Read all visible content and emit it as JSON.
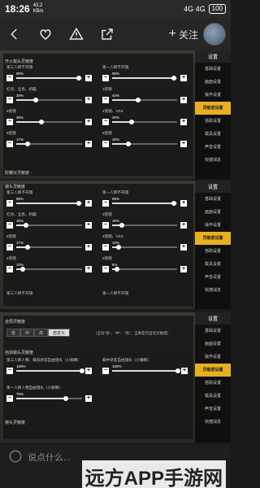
{
  "status": {
    "time": "18:26",
    "net_speed": "43.2",
    "net_unit": "KB/s",
    "signal": "4G 4G",
    "battery": "100"
  },
  "nav": {
    "follow": "关注",
    "plus": "+"
  },
  "menu": {
    "title": "设置",
    "items": [
      "基础设置",
      "画面设置",
      "操作设置",
      "灵敏度设置",
      "拾取设置",
      "载具设置",
      "声音设置",
      "快捷消息"
    ],
    "active_index": 3
  },
  "shot1": {
    "section": "开火镜头灵敏度",
    "left_col": [
      {
        "label": "第三人称不开镜",
        "pct": "95%",
        "value": 95
      },
      {
        "label": "红点、全息、机瞄",
        "pct": "30%",
        "value": 30
      },
      {
        "label": "8倍镜",
        "pct": "38%",
        "value": 38
      },
      {
        "label": "6倍镜",
        "pct": "17%",
        "value": 17
      }
    ],
    "right_col": [
      {
        "label": "第一人称不开镜",
        "pct": "95%",
        "value": 95
      },
      {
        "label": "2倍镜",
        "pct": "40%",
        "value": 40
      },
      {
        "label": "4倍镜、VSS",
        "pct": "30%",
        "value": 30
      },
      {
        "label": "8倍镜",
        "pct": "25%",
        "value": 25
      }
    ],
    "footer": "陀螺仪灵敏度 -"
  },
  "shot2": {
    "section": "镜头灵敏度",
    "left_col": [
      {
        "label": "第三人称不开镜",
        "pct": "95%",
        "value": 95
      },
      {
        "label": "红点、全息、机瞄",
        "pct": "15%",
        "value": 15
      },
      {
        "label": "8倍镜",
        "pct": "17%",
        "value": 17
      },
      {
        "label": "4倍镜",
        "pct": "10%",
        "value": 10
      }
    ],
    "right_col": [
      {
        "label": "第一人称不开镜",
        "pct": "95%",
        "value": 95
      },
      {
        "label": "2倍镜",
        "pct": "15%",
        "value": 15
      },
      {
        "label": "4倍镜、VSS",
        "pct": "10%",
        "value": 10
      },
      {
        "label": "6倍镜",
        "pct": "8%",
        "value": 8
      }
    ],
    "footer_left": "第三人称不开镜",
    "footer_right": "第一人称不开镜"
  },
  "shot3": {
    "section": "全局灵敏度",
    "segments": [
      "低",
      "中",
      "高",
      "自定义"
    ],
    "active_segment": 3,
    "hint": "(全局\"低\"、\"中\"、\"高\"，当真是可自的灵敏度)",
    "sub_section": "自动镜头灵敏度",
    "rows": [
      {
        "label": "第三人称人物、载具状态自由镜头（小眼睛）",
        "pct": "100%",
        "value": 100
      },
      {
        "label": "载中状态自由镜头（小眼睛）",
        "pct": "100%",
        "value": 100
      },
      {
        "label": "第一人称人物自由镜头（小眼睛）",
        "pct": "75%",
        "value": 75
      }
    ],
    "footer": "镜头灵敏度"
  },
  "comment": {
    "placeholder": "说点什么..."
  },
  "watermark": "远方APP手游网"
}
